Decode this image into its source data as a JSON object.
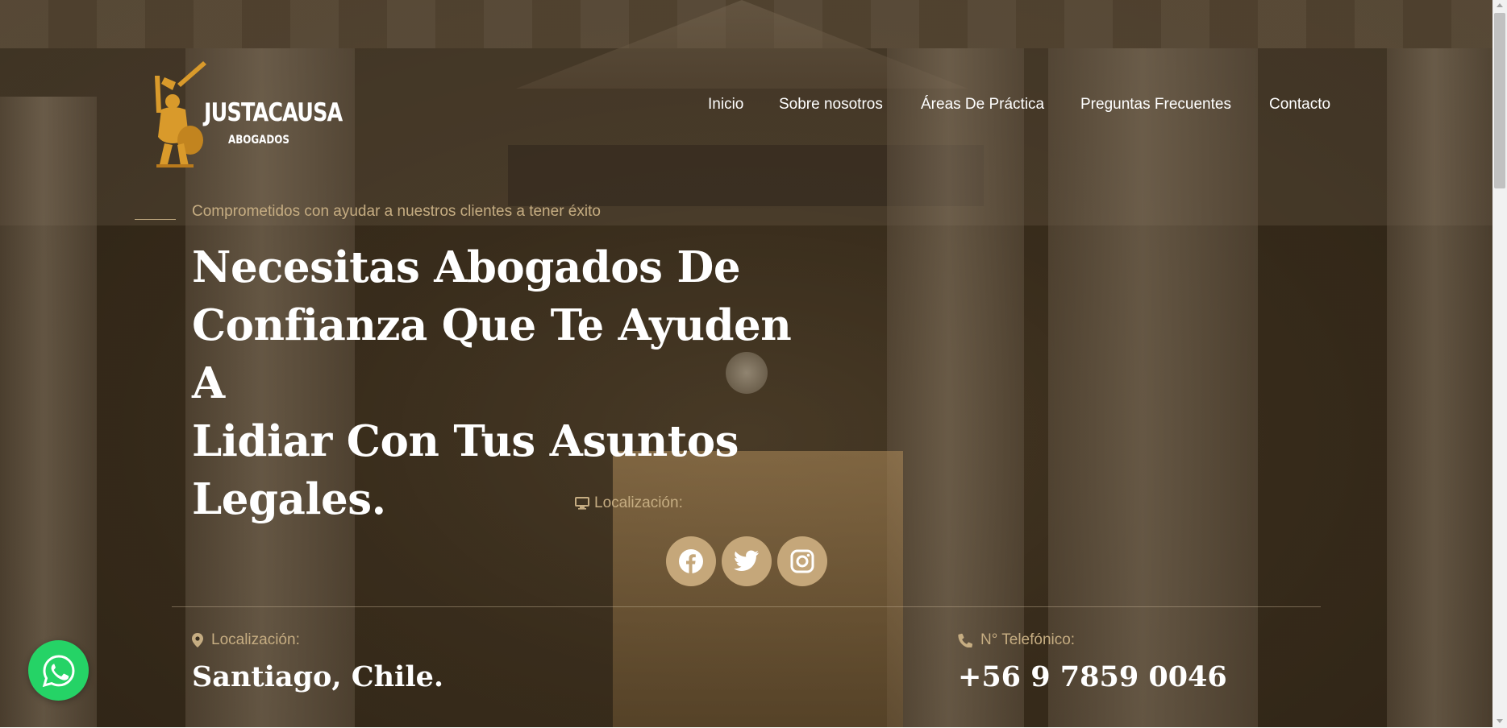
{
  "header": {
    "logo_name": "JUSTACAUSA",
    "logo_sub": "ABOGADOS",
    "nav": [
      {
        "label": "Inicio"
      },
      {
        "label": "Sobre nosotros"
      },
      {
        "label": "Áreas De Práctica"
      },
      {
        "label": "Preguntas Frecuentes"
      },
      {
        "label": "Contacto"
      }
    ]
  },
  "hero": {
    "tagline": "Comprometidos con ayudar a nuestros clientes a tener éxito",
    "headline_lines": [
      "Necesitas Abogados De",
      "Confianza Que Te Ayuden A",
      "Lidiar Con Tus Asuntos",
      "Legales."
    ],
    "location_label": "Localización:"
  },
  "socials": [
    {
      "icon": "facebook-icon"
    },
    {
      "icon": "twitter-icon"
    },
    {
      "icon": "instagram-icon"
    }
  ],
  "info": {
    "location": {
      "label": "Localización:",
      "value": "Santiago, Chile."
    },
    "phone": {
      "label": "N° Telefónico:",
      "value": "+56 9 7859 0046"
    }
  },
  "colors": {
    "accent": "#c5a77a",
    "whatsapp": "#25d366"
  }
}
